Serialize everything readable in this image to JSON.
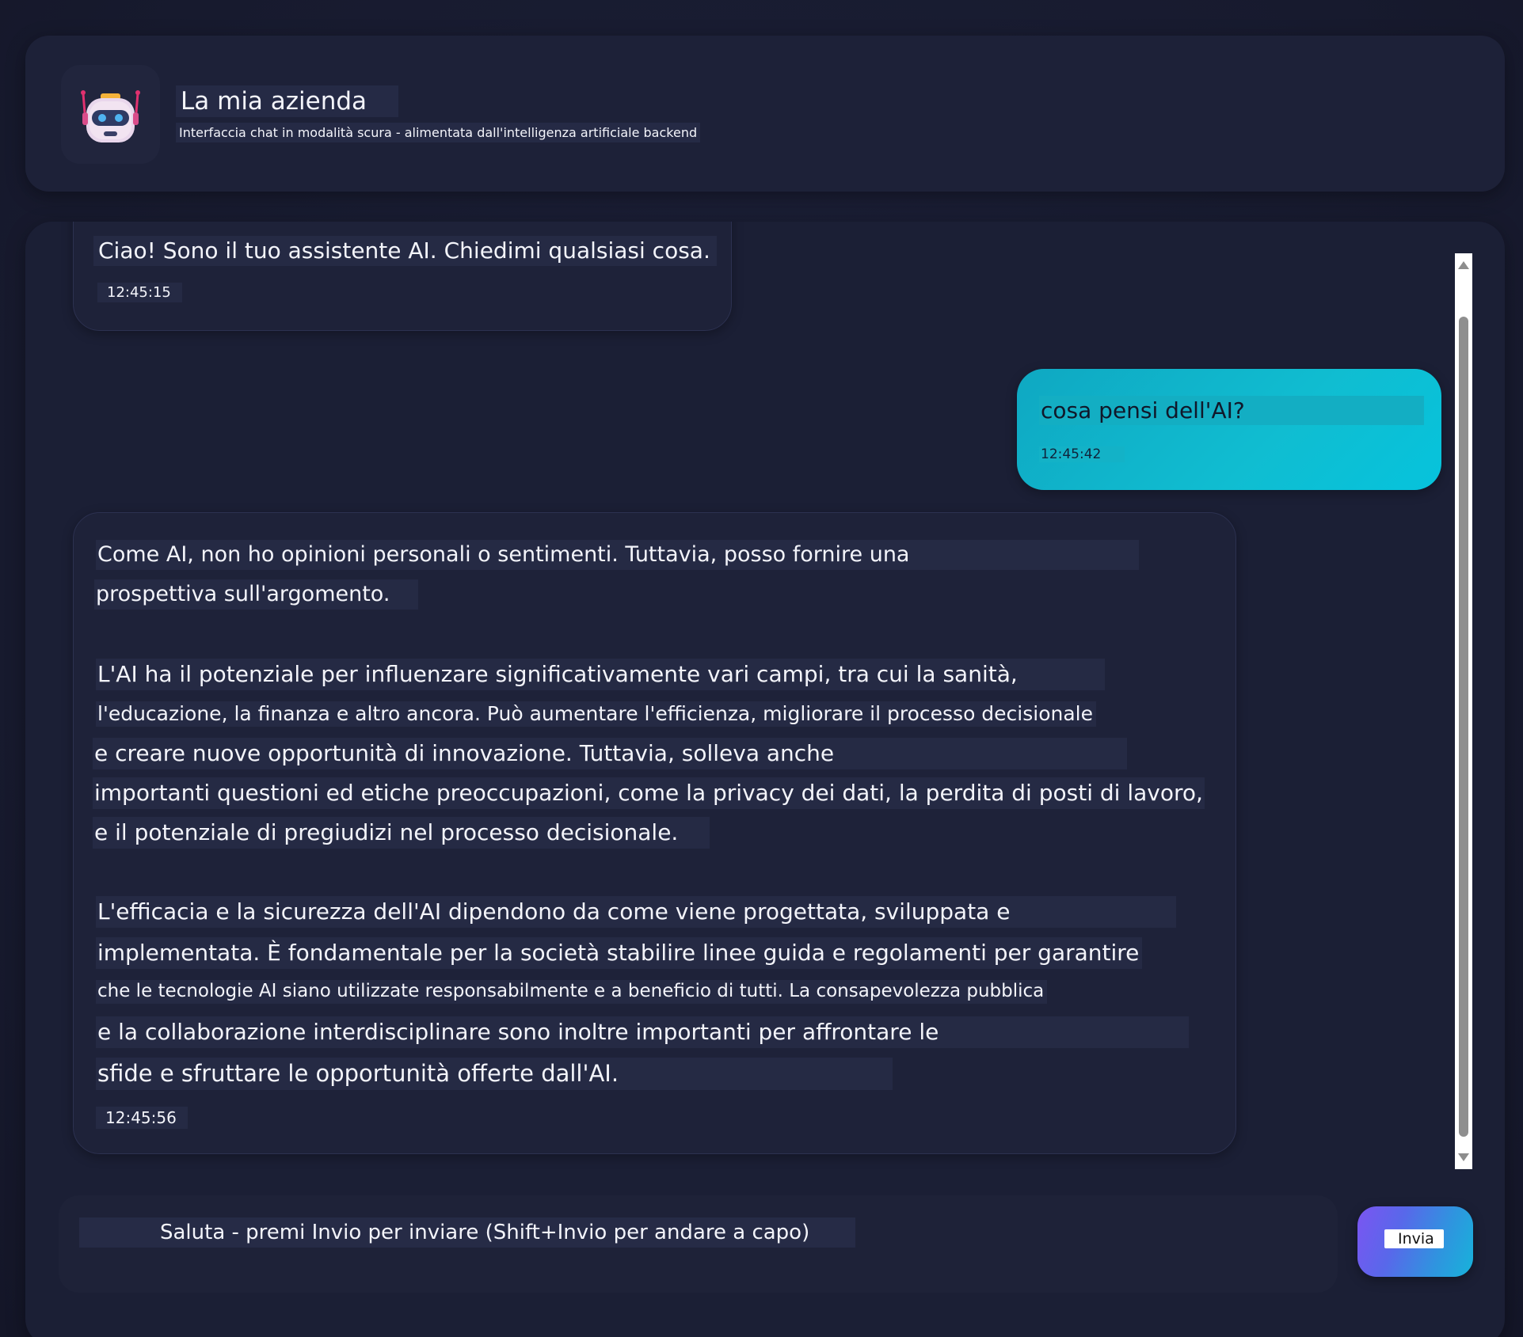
{
  "header": {
    "title": "La mia azienda",
    "subtitle": "Interfaccia chat in modalità scura - alimentata dall'intelligenza artificiale backend",
    "logo_icon": "robot-icon"
  },
  "messages": [
    {
      "role": "assistant",
      "lines": [
        "Ciao! Sono il tuo assistente AI. Chiedimi qualsiasi cosa."
      ],
      "time": "12:45:15"
    },
    {
      "role": "user",
      "lines": [
        "cosa pensi dell'AI?"
      ],
      "time": "12:45:42"
    },
    {
      "role": "assistant",
      "lines": [
        "Come AI, non ho opinioni personali o sentimenti. Tuttavia, posso fornire una",
        "prospettiva sull'argomento.",
        "L'AI ha il potenziale per influenzare significativamente vari campi, tra cui la sanità,",
        "l'educazione, la finanza e altro ancora. Può aumentare l'efficienza, migliorare il processo decisionale",
        "e creare nuove opportunità di innovazione. Tuttavia, solleva anche",
        "importanti questioni ed etiche preoccupazioni, come la privacy dei dati, la perdita di posti di lavoro,",
        "e il potenziale di pregiudizi nel processo decisionale.",
        "L'efficacia e la sicurezza dell'AI dipendono da come viene progettata, sviluppata e",
        "implementata. È fondamentale per la società stabilire linee guida e regolamenti per garantire",
        "che le tecnologie AI siano utilizzate responsabilmente e a beneficio di tutti. La consapevolezza pubblica",
        "e la collaborazione interdisciplinare sono inoltre importanti per affrontare le",
        "sfide e sfruttare le opportunità offerte dall'AI."
      ],
      "time": "12:45:56"
    }
  ],
  "input": {
    "placeholder": "Saluta - premi Invio per inviare (Shift+Invio per andare a capo)",
    "value": ""
  },
  "send_button": {
    "label": "Invia"
  },
  "colors": {
    "background": "#181b30",
    "card": "#1d2138",
    "user_bubble": "#10bdd1",
    "accent_gradient_start": "#7b55f2",
    "accent_gradient_end": "#17b3da",
    "text": "#f3f4fa"
  }
}
